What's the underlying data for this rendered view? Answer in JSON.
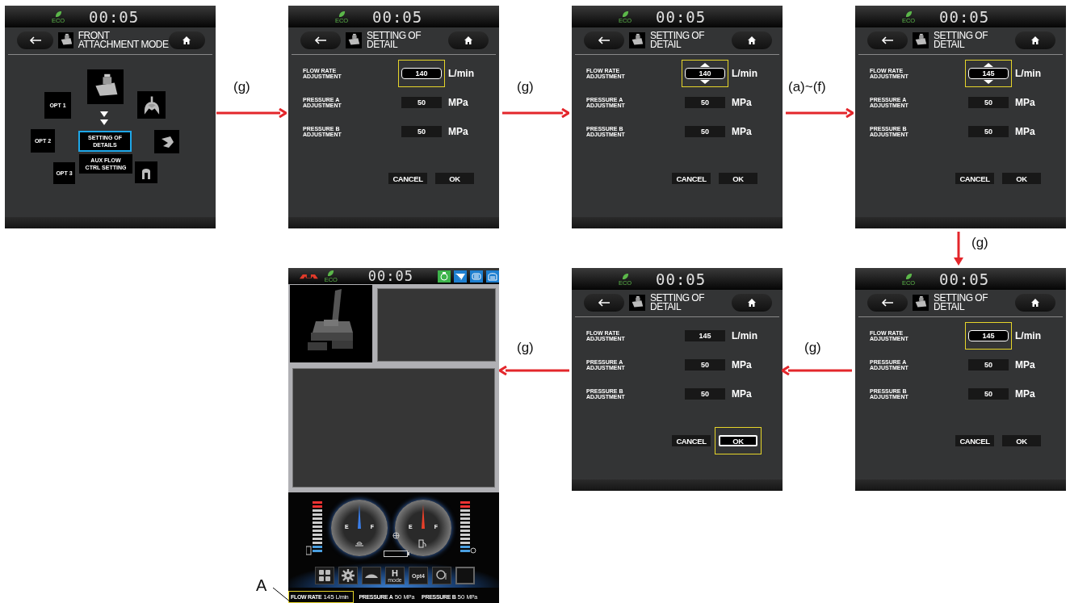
{
  "screens": [
    {
      "kind": "mode",
      "eco": "ECO",
      "clock": "00:05",
      "title": [
        "FRONT",
        "ATTACHMENT MODE"
      ],
      "options": [
        {
          "label": "OPT 1"
        },
        {
          "label": "OPT 2"
        },
        {
          "label": "OPT 3"
        }
      ],
      "menu": [
        {
          "label": "SETTING OF DETAILS",
          "selected": true
        },
        {
          "label": "AUX FLOW CTRL SETTING",
          "selected": false
        }
      ]
    },
    {
      "kind": "detail",
      "eco": "ECO",
      "clock": "00:05",
      "title": [
        "SETTING OF",
        "DETAIL"
      ],
      "rows": [
        {
          "label": "FLOW RATE ADJUSTMENT",
          "value": "140",
          "unit": "L/min",
          "focused": true,
          "editing": false
        },
        {
          "label": "PRESSURE A ADJUSTMENT",
          "value": "50",
          "unit": "MPa",
          "focused": false,
          "editing": false
        },
        {
          "label": "PRESSURE B ADJUSTMENT",
          "value": "50",
          "unit": "MPa",
          "focused": false,
          "editing": false
        }
      ],
      "buttons": [
        {
          "label": "CANCEL",
          "focused": false
        },
        {
          "label": "OK",
          "focused": false
        }
      ]
    },
    {
      "kind": "detail",
      "eco": "ECO",
      "clock": "00:05",
      "title": [
        "SETTING OF",
        "DETAIL"
      ],
      "rows": [
        {
          "label": "FLOW RATE ADJUSTMENT",
          "value": "140",
          "unit": "L/min",
          "focused": true,
          "editing": true
        },
        {
          "label": "PRESSURE A ADJUSTMENT",
          "value": "50",
          "unit": "MPa",
          "focused": false,
          "editing": false
        },
        {
          "label": "PRESSURE B ADJUSTMENT",
          "value": "50",
          "unit": "MPa",
          "focused": false,
          "editing": false
        }
      ],
      "buttons": [
        {
          "label": "CANCEL",
          "focused": false
        },
        {
          "label": "OK",
          "focused": false
        }
      ]
    },
    {
      "kind": "detail",
      "eco": "ECO",
      "clock": "00:05",
      "title": [
        "SETTING OF",
        "DETAIL"
      ],
      "rows": [
        {
          "label": "FLOW RATE ADJUSTMENT",
          "value": "145",
          "unit": "L/min",
          "focused": true,
          "editing": true
        },
        {
          "label": "PRESSURE A ADJUSTMENT",
          "value": "50",
          "unit": "MPa",
          "focused": false,
          "editing": false
        },
        {
          "label": "PRESSURE B ADJUSTMENT",
          "value": "50",
          "unit": "MPa",
          "focused": false,
          "editing": false
        }
      ],
      "buttons": [
        {
          "label": "CANCEL",
          "focused": false
        },
        {
          "label": "OK",
          "focused": false
        }
      ]
    },
    {
      "kind": "main",
      "eco": "ECO",
      "clock": "00:05",
      "gauges": [
        {
          "low": "E",
          "high": "F"
        },
        {
          "low": "E",
          "high": "F"
        }
      ],
      "softkeys": [
        {
          "kind": "grid"
        },
        {
          "kind": "gear"
        },
        {
          "kind": "mound"
        },
        {
          "kind": "mode",
          "label": "H",
          "sublabel": "mode"
        },
        {
          "kind": "text",
          "label": "Opt4"
        },
        {
          "kind": "auto"
        },
        {
          "kind": "blank"
        }
      ],
      "status": [
        {
          "label": "FLOW RATE",
          "value": "145",
          "unit": "L/min",
          "focused": true
        },
        {
          "label": "PRESSURE A",
          "value": "50",
          "unit": "MPa",
          "focused": false
        },
        {
          "label": "PRESSURE B",
          "value": "50",
          "unit": "MPa",
          "focused": false
        }
      ]
    },
    {
      "kind": "detail",
      "eco": "ECO",
      "clock": "00:05",
      "title": [
        "SETTING OF",
        "DETAIL"
      ],
      "rows": [
        {
          "label": "FLOW RATE ADJUSTMENT",
          "value": "145",
          "unit": "L/min",
          "focused": false,
          "editing": false
        },
        {
          "label": "PRESSURE A ADJUSTMENT",
          "value": "50",
          "unit": "MPa",
          "focused": false,
          "editing": false
        },
        {
          "label": "PRESSURE B ADJUSTMENT",
          "value": "50",
          "unit": "MPa",
          "focused": false,
          "editing": false
        }
      ],
      "buttons": [
        {
          "label": "CANCEL",
          "focused": false
        },
        {
          "label": "OK",
          "focused": true
        }
      ]
    },
    {
      "kind": "detail",
      "eco": "ECO",
      "clock": "00:05",
      "title": [
        "SETTING OF",
        "DETAIL"
      ],
      "rows": [
        {
          "label": "FLOW RATE ADJUSTMENT",
          "value": "145",
          "unit": "L/min",
          "focused": true,
          "editing": false
        },
        {
          "label": "PRESSURE A ADJUSTMENT",
          "value": "50",
          "unit": "MPa",
          "focused": false,
          "editing": false
        },
        {
          "label": "PRESSURE B ADJUSTMENT",
          "value": "50",
          "unit": "MPa",
          "focused": false,
          "editing": false
        }
      ],
      "buttons": [
        {
          "label": "CANCEL",
          "focused": false
        },
        {
          "label": "OK",
          "focused": false
        }
      ]
    }
  ],
  "arrows": [
    {
      "label": "(g)"
    },
    {
      "label": "(g)"
    },
    {
      "label": "(a)~(f)"
    },
    {
      "label": "(g)"
    },
    {
      "label": "(g)"
    },
    {
      "label": "(g)"
    }
  ],
  "callout": {
    "label": "A"
  }
}
